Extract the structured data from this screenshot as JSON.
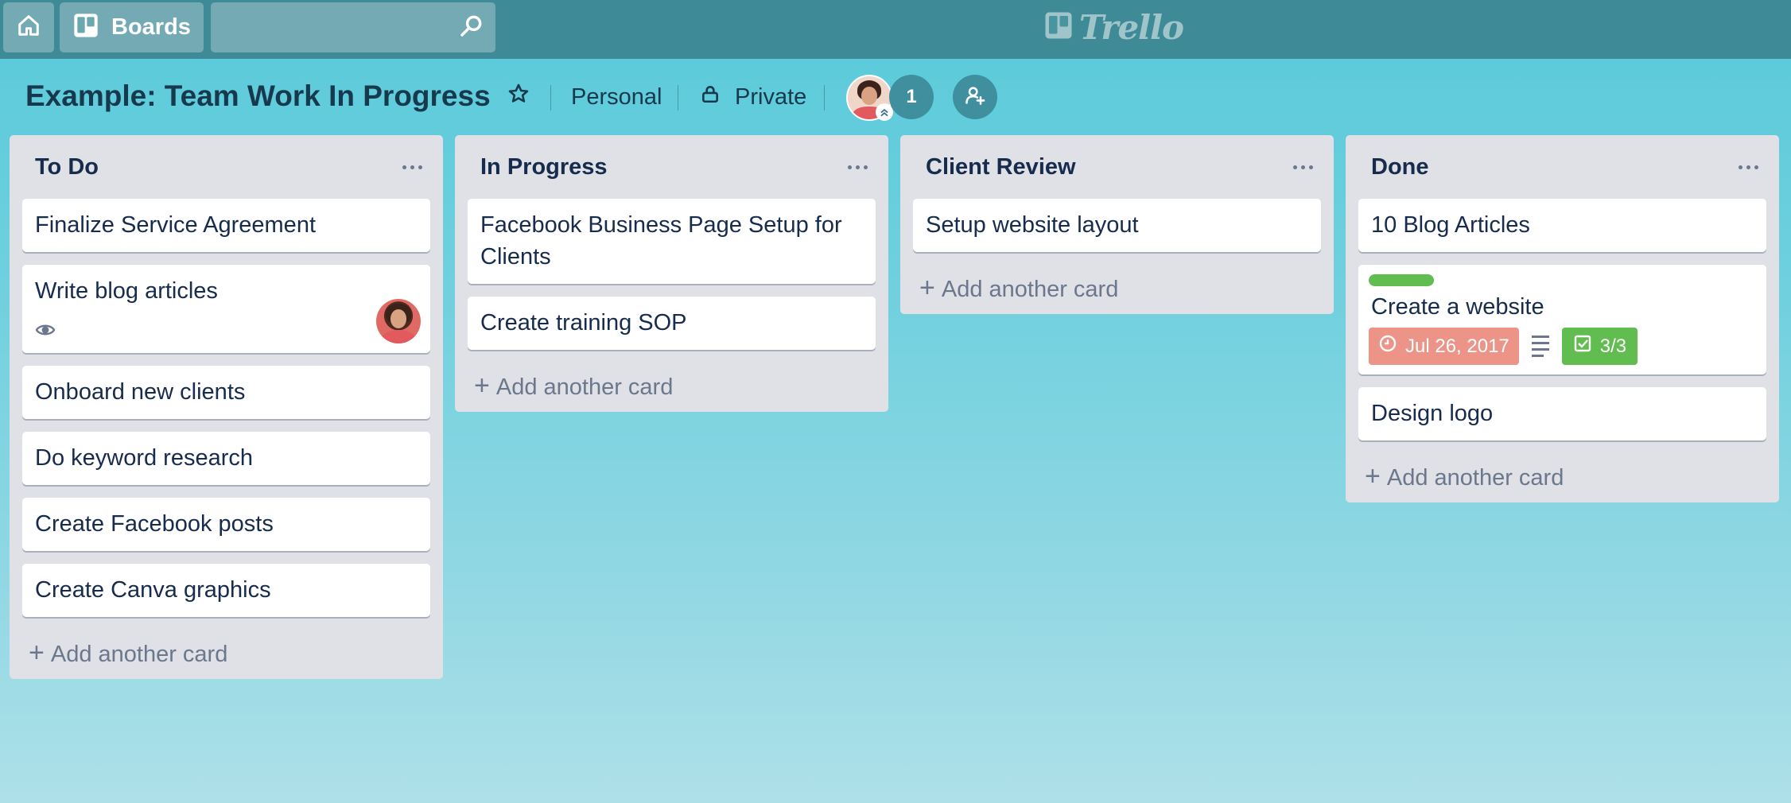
{
  "header": {
    "home_icon": "home-icon",
    "boards_label": "Boards",
    "search_placeholder": "",
    "logo_text": "Trello"
  },
  "board": {
    "title": "Example: Team Work In Progress",
    "team": "Personal",
    "visibility": "Private",
    "member_count": "1"
  },
  "lists": [
    {
      "title": "To Do",
      "cards": [
        {
          "title": "Finalize Service Agreement"
        },
        {
          "title": "Write blog articles"
        },
        {
          "title": "Onboard new clients"
        },
        {
          "title": "Do keyword research"
        },
        {
          "title": "Create Facebook posts"
        },
        {
          "title": "Create Canva graphics"
        }
      ],
      "add_label": "Add another card"
    },
    {
      "title": "In Progress",
      "cards": [
        {
          "title": "Facebook Business Page Setup for Clients"
        },
        {
          "title": "Create training SOP"
        }
      ],
      "add_label": "Add another card"
    },
    {
      "title": "Client Review",
      "cards": [
        {
          "title": "Setup website layout"
        }
      ],
      "add_label": "Add another card"
    },
    {
      "title": "Done",
      "cards": [
        {
          "title": "10 Blog Articles"
        },
        {
          "title": "Create a website",
          "due": "Jul 26, 2017",
          "checklist": "3/3",
          "label_color": "#61bd4f"
        },
        {
          "title": "Design logo"
        }
      ],
      "add_label": "Add another card"
    }
  ],
  "colors": {
    "header_bg": "#3e8a96",
    "list_bg": "#dfe1e6",
    "due_badge": "#ec9488",
    "checklist_badge": "#61bd4f",
    "green_label": "#61bd4f"
  }
}
